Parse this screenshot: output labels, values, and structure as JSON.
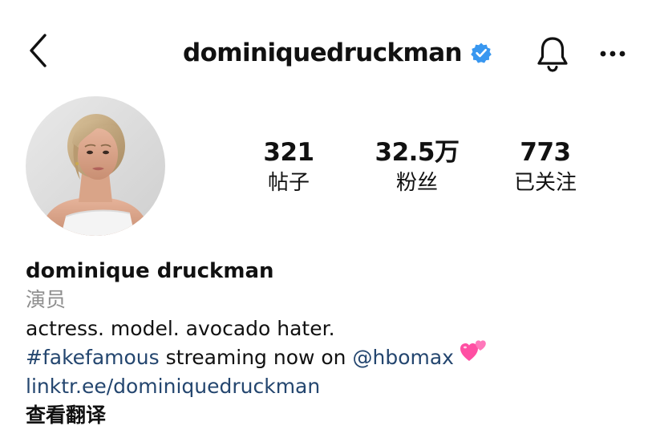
{
  "header": {
    "username": "dominiquedruckman",
    "back_icon": "chevron-left-icon",
    "verified_icon": "verified-badge-icon",
    "bell_icon": "bell-icon",
    "more_icon": "more-horizontal-icon"
  },
  "stats": {
    "posts": {
      "value": "321",
      "label": "帖子"
    },
    "followers": {
      "value": "32.5万",
      "label": "粉丝"
    },
    "following": {
      "value": "773",
      "label": "已关注"
    }
  },
  "bio": {
    "name": "dominique druckman",
    "category": "演员",
    "line1": "actress. model. avocado hater.",
    "hashtag": "#fakefamous",
    "middle_text": " streaming now on ",
    "mention": "@hbomax",
    "emoji_icon": "two-hearts-emoji-icon",
    "link": "linktr.ee/dominiquedruckman",
    "translate_label": "查看翻译"
  },
  "colors": {
    "text": "#111111",
    "secondary_text": "#8e8e8e",
    "link": "#24466f",
    "verified_blue": "#3897f0",
    "heart_pink": "#ff4fa3"
  }
}
